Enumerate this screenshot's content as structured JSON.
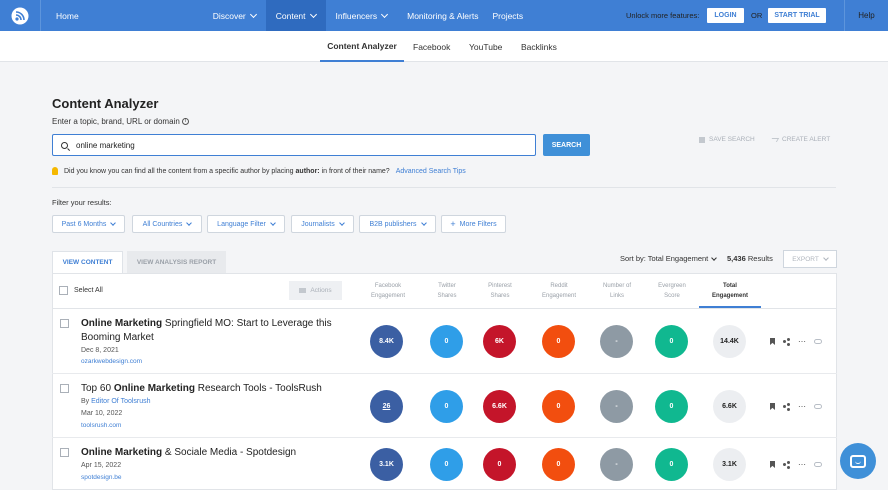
{
  "topnav": {
    "home": "Home",
    "discover": "Discover",
    "content": "Content",
    "influencers": "Influencers",
    "monitoring": "Monitoring & Alerts",
    "projects": "Projects",
    "unlock": "Unlock more features:",
    "login": "LOGIN",
    "or": "OR",
    "trial": "START TRIAL",
    "help": "Help"
  },
  "subtabs": [
    "Content Analyzer",
    "Facebook",
    "YouTube",
    "Backlinks"
  ],
  "page": {
    "title": "Content Analyzer",
    "search_label": "Enter a topic, brand, URL or domain",
    "search_value": "online marketing",
    "search_button": "SEARCH",
    "save_search": "SAVE SEARCH",
    "create_alert": "CREATE ALERT",
    "tip_pre": "Did you know you can find all the content from a specific author by placing",
    "tip_bold": "author:",
    "tip_post": "in front of their name?",
    "tip_link": "Advanced Search Tips",
    "filter_label": "Filter your results:"
  },
  "filters": [
    "Past 6 Months",
    "All Countries",
    "Language Filter",
    "Journalists",
    "B2B publishers",
    "More Filters"
  ],
  "results": {
    "tab_view": "VIEW CONTENT",
    "tab_analysis": "VIEW ANALYSIS REPORT",
    "sort_label": "Sort by: Total Engagement",
    "count": "5,436",
    "count_suffix": "Results",
    "export": "EXPORT",
    "select_all": "Select All",
    "actions": "Actions",
    "columns": [
      [
        "Facebook",
        "Engagement"
      ],
      [
        "Twitter",
        "Shares"
      ],
      [
        "Pinterest",
        "Shares"
      ],
      [
        "Reddit",
        "Engagement"
      ],
      [
        "Number of",
        "Links"
      ],
      [
        "Evergreen",
        "Score"
      ],
      [
        "Total",
        "Engagement"
      ]
    ]
  },
  "rows": [
    {
      "title_bold": "Online Marketing",
      "title_rest": " Springfield MO: Start to Leverage this Booming Market",
      "date": "Dec 8, 2021",
      "domain": "ozarkwebdesign.com",
      "metrics": [
        "8.4K",
        "0",
        "6K",
        "0",
        "-",
        "0",
        "14.4K"
      ]
    },
    {
      "title_pre": "Top 60 ",
      "title_bold": "Online Marketing",
      "title_rest": " Research Tools - ToolsRush",
      "by": "By",
      "author": "Editor Of Toolsrush",
      "date": "Mar 10, 2022",
      "domain": "toolsrush.com",
      "metrics": [
        "26",
        "0",
        "6.6K",
        "0",
        "-",
        "0",
        "6.6K"
      ]
    },
    {
      "title_bold": "Online Marketing",
      "title_rest": " & Sociale Media - Spotdesign",
      "date": "Apr 15, 2022",
      "domain": "spotdesign.be",
      "metrics": [
        "3.1K",
        "0",
        "0",
        "0",
        "-",
        "0",
        "3.1K"
      ]
    }
  ],
  "colors": {
    "nav": "#3f7fd4",
    "facebook": "#3b5fa3",
    "twitter": "#2f9ee8",
    "pinterest": "#c4152a",
    "reddit": "#f24e0f",
    "links": "#8e9aa4",
    "evergreen": "#10b890"
  },
  "icons": [
    "logo-icon",
    "search-icon",
    "bulb-icon",
    "bookmark-icon",
    "share-icon",
    "more-icon",
    "link-icon",
    "chat-icon"
  ]
}
